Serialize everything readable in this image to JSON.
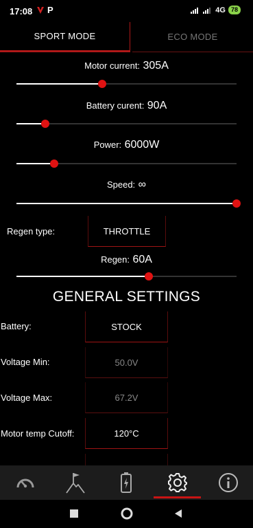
{
  "status_bar": {
    "time": "17:08",
    "app_icon_2": "P",
    "network": "4G",
    "battery": "78"
  },
  "tabs": [
    {
      "label": "SPORT MODE",
      "active": true
    },
    {
      "label": "ECO MODE",
      "active": false
    }
  ],
  "sliders": {
    "motor_current": {
      "label": "Motor current:",
      "value": "305A",
      "level": 0.39
    },
    "battery_current": {
      "label": "Battery curent:",
      "value": "90A",
      "level": 0.13
    },
    "power": {
      "label": "Power:",
      "value": "6000W",
      "level": 0.17
    },
    "speed": {
      "label": "Speed:",
      "value": "∞",
      "level": 1.0
    },
    "regen": {
      "label": "Regen:",
      "value": "60A",
      "level": 0.6
    }
  },
  "regen_type": {
    "label": "Regen type:",
    "value": "THROTTLE"
  },
  "general": {
    "heading": "GENERAL SETTINGS",
    "battery": {
      "label": "Battery:",
      "value": "STOCK"
    },
    "voltage_min": {
      "label": "Voltage Min:",
      "value": "50.0V"
    },
    "voltage_max": {
      "label": "Voltage Max:",
      "value": "67.2V"
    },
    "motor_temp_cutoff": {
      "label": "Motor temp Cutoff:",
      "value": "120°C"
    }
  },
  "bottom_nav": [
    {
      "icon": "speedometer-icon",
      "active": false
    },
    {
      "icon": "mountain-flag-icon",
      "active": false
    },
    {
      "icon": "battery-charging-icon",
      "active": false
    },
    {
      "icon": "gear-icon",
      "active": true
    },
    {
      "icon": "info-icon",
      "active": false
    }
  ],
  "colors": {
    "accent": "#e01212",
    "background": "#000000",
    "nav_background": "#1c1c1c"
  }
}
